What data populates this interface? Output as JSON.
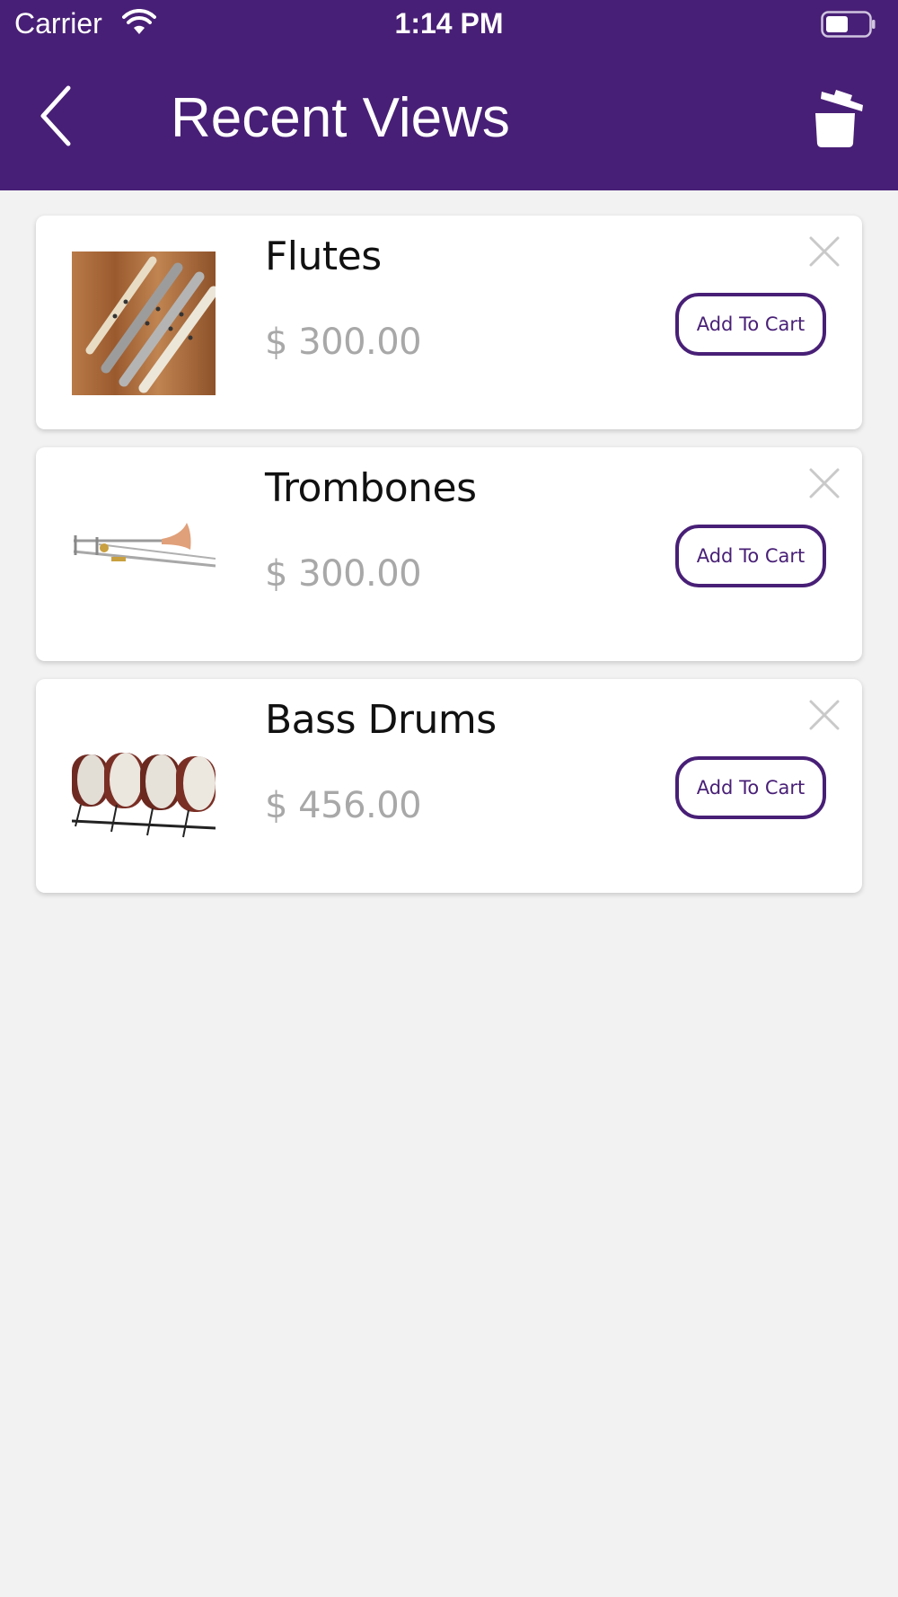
{
  "status_bar": {
    "carrier": "Carrier",
    "time": "1:14 PM"
  },
  "header": {
    "title": "Recent Views",
    "back_icon": "chevron-left-icon",
    "trash_icon": "trash-icon"
  },
  "colors": {
    "brand": "#481f76",
    "price": "#a8a8a8",
    "background": "#f2f2f2"
  },
  "items": [
    {
      "name": "Flutes",
      "price": "$ 300.00",
      "button": "Add To Cart",
      "image": "flutes-photo"
    },
    {
      "name": "Trombones",
      "price": "$ 300.00",
      "button": "Add To Cart",
      "image": "trombone-photo"
    },
    {
      "name": "Bass Drums",
      "price": "$ 456.00",
      "button": "Add To Cart",
      "image": "bass-drums-photo"
    }
  ]
}
